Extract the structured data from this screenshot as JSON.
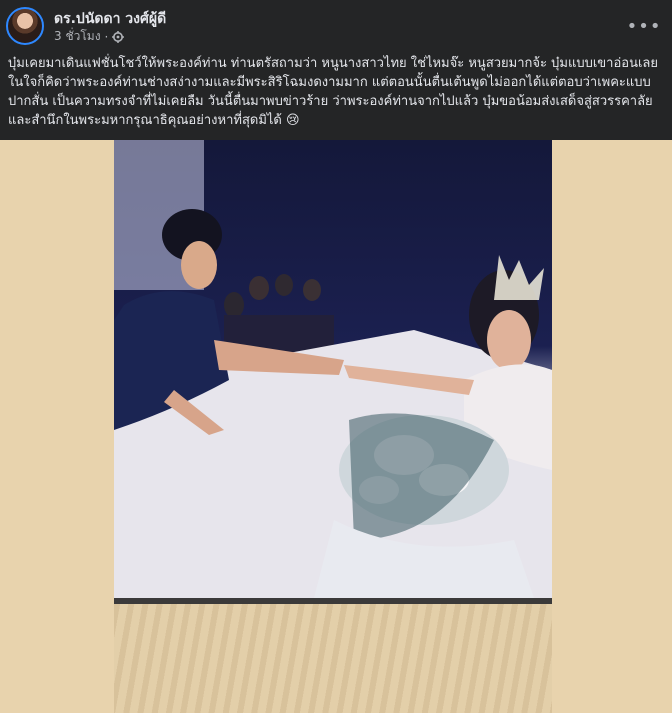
{
  "post": {
    "author": "ดร.ปนัดดา วงศ์ผู้ดี",
    "time": "3 ชั่วโมง",
    "separator": "·",
    "more_label": "•••",
    "text": "บุ๋มเคยมาเดินแฟชั่นโชว์ให้พระองค์ท่าน ท่านตรัสถามว่า หนูนางสาวไทย ใช่ไหมจ๊ะ หนูสวยมากจ้ะ บุ๋มแบบเขาอ่อนเลย ในใจก็คิดว่าพระองค์ท่านช่างสง่างามและมีพระสิริโฉมงดงามมาก แต่ตอนนั้นตื่นเต้นพูดไม่ออกได้แต่ตอบว่าเพคะแบบ ปากสั่น เป็นความทรงจำที่ไม่เคยลืม วันนี้ตื่นมาพบข่าวร้าย ว่าพระองค์ท่านจากไปแล้ว บุ๋มขอน้อมส่งเสด็จสู่สวรรคาลัย และสำนึกในพระมหากรุณาธิคุณอย่างหาที่สุดมิได้ 😢"
  },
  "colors": {
    "background": "#242526",
    "text": "#e4e6eb",
    "secondary_text": "#b0b3b8",
    "avatar_ring": "#2d88ff",
    "media_background": "#e8d3ad"
  },
  "icons": {
    "privacy": "gear-icon",
    "more": "more-horizontal-icon"
  }
}
